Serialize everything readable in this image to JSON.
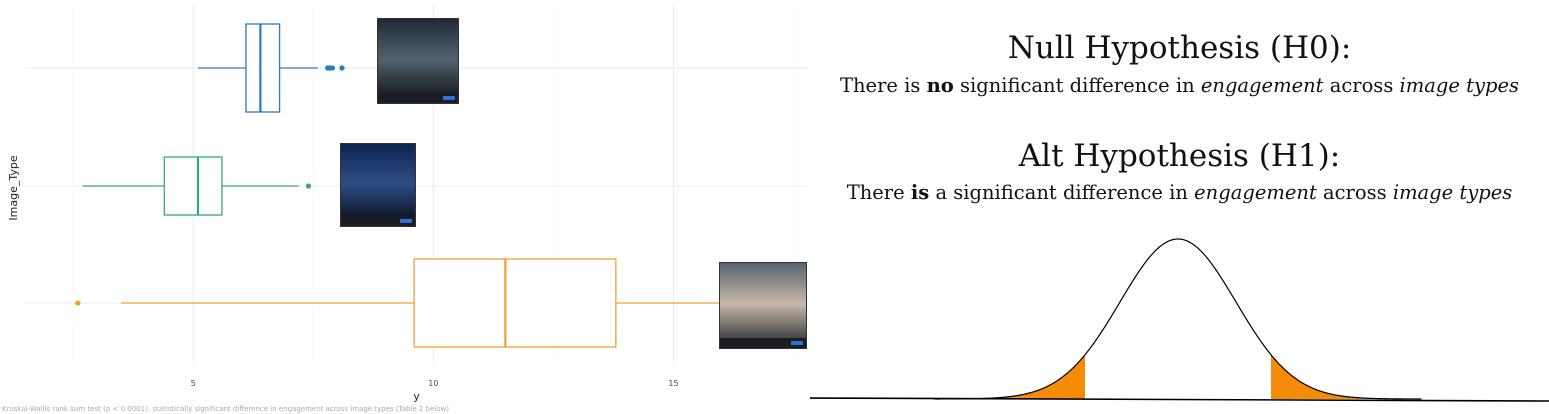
{
  "chart_data": {
    "type": "boxplot",
    "orientation": "horizontal",
    "xlabel": "y",
    "ylabel": "Image_Type",
    "xlim": [
      1.5,
      17.8
    ],
    "xticks": [
      "5",
      "10",
      "15"
    ],
    "grid": true,
    "legend": "none",
    "series": [
      {
        "color": "#f0a030",
        "whisker_low": 3.5,
        "q1": 9.6,
        "median": 11.5,
        "q3": 13.8,
        "whisker_high": 17.0,
        "outliers": [
          2.6
        ]
      },
      {
        "color": "#3aa58a",
        "whisker_low": 2.7,
        "q1": 4.4,
        "median": 5.1,
        "q3": 5.6,
        "whisker_high": 7.2,
        "outliers": [
          7.4
        ]
      },
      {
        "color": "#2b7bba",
        "whisker_low": 5.1,
        "q1": 6.1,
        "median": 6.4,
        "q3": 6.8,
        "whisker_high": 7.6,
        "outliers": [
          7.8,
          7.85,
          7.9,
          8.1
        ]
      }
    ]
  },
  "thumbnails": [
    {
      "name": "city-skyline-night-thumbnail",
      "colors": [
        "#1f2a38",
        "#53616f",
        "#0c0f12"
      ]
    },
    {
      "name": "starry-lake-night-thumbnail",
      "colors": [
        "#0e2450",
        "#2d4e86",
        "#05080f"
      ]
    },
    {
      "name": "child-with-baby-thumbnail",
      "colors": [
        "#58626e",
        "#c7b8a9",
        "#20242a"
      ]
    }
  ],
  "caption": "Kruskal-Wallis rank sum test (p < 0.0001): statistically significant difference in engagement across image types (Table 2 below)",
  "hypotheses": {
    "null_title": "Null Hypothesis (H0):",
    "null_pre": "There is ",
    "null_bold": "no",
    "null_mid": " significant difference in ",
    "null_em1": "engagement",
    "null_mid2": " across ",
    "null_em2": "image types",
    "alt_title": "Alt Hypothesis (H1):",
    "alt_pre": "There ",
    "alt_bold": "is",
    "alt_mid": " a significant difference in ",
    "alt_em1": "engagement",
    "alt_mid2": " across ",
    "alt_em2": "image types"
  },
  "bell_curve": {
    "tail_color": "#f68b0a",
    "line_color": "#000000",
    "critical_z": 1.6
  }
}
